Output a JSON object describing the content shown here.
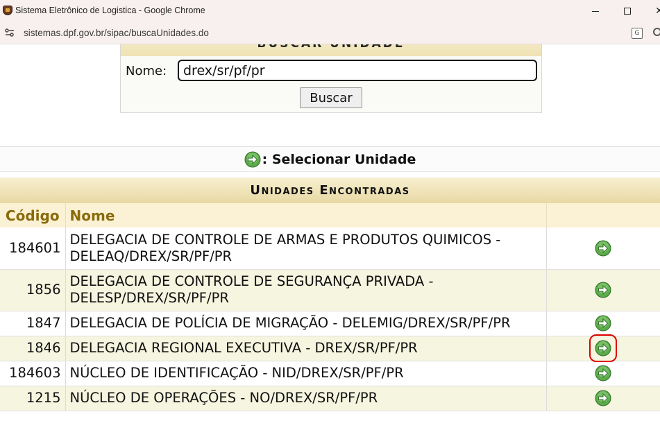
{
  "window": {
    "title": "Sistema Eletrônico de Logistica - Google Chrome",
    "url": "sistemas.dpf.gov.br/sipac/buscaUnidades.do"
  },
  "search": {
    "caption": "BUSCAR UNIDADE",
    "name_label": "Nome:",
    "name_value": "drex/sr/pf/pr",
    "button_label": "Buscar"
  },
  "legend": {
    "text": ": Selecionar Unidade",
    "icon": "green-arrow-icon"
  },
  "results": {
    "caption": "Unidades Encontradas",
    "headers": {
      "code": "Código",
      "name": "Nome",
      "action": ""
    },
    "rows": [
      {
        "code": "184601",
        "name_line1": "DELEGACIA DE CONTROLE DE ARMAS E PRODUTOS QUIMICOS -",
        "name_line2": "DELEAQ/DREX/SR/PF/PR"
      },
      {
        "code": "1856",
        "name_line1": "DELEGACIA DE CONTROLE DE SEGURANÇA PRIVADA -",
        "name_line2": "DELESP/DREX/SR/PF/PR"
      },
      {
        "code": "1847",
        "name_line1": "DELEGACIA DE POLÍCIA DE MIGRAÇÃO - DELEMIG/DREX/SR/PF/PR",
        "name_line2": ""
      },
      {
        "code": "1846",
        "name_line1": "DELEGACIA REGIONAL EXECUTIVA - DREX/SR/PF/PR",
        "name_line2": ""
      },
      {
        "code": "184603",
        "name_line1": "NÚCLEO DE IDENTIFICAÇÃO - NID/DREX/SR/PF/PR",
        "name_line2": ""
      },
      {
        "code": "1215",
        "name_line1": "NÚCLEO DE OPERAÇÕES - NO/DREX/SR/PF/PR",
        "name_line2": ""
      }
    ]
  },
  "colors": {
    "caption_bg": "#efe2b3",
    "header_text": "#8a6b0b",
    "row_alt": "#f5f5e0",
    "highlight": "#e00000",
    "icon_green": "#5cab4a"
  }
}
